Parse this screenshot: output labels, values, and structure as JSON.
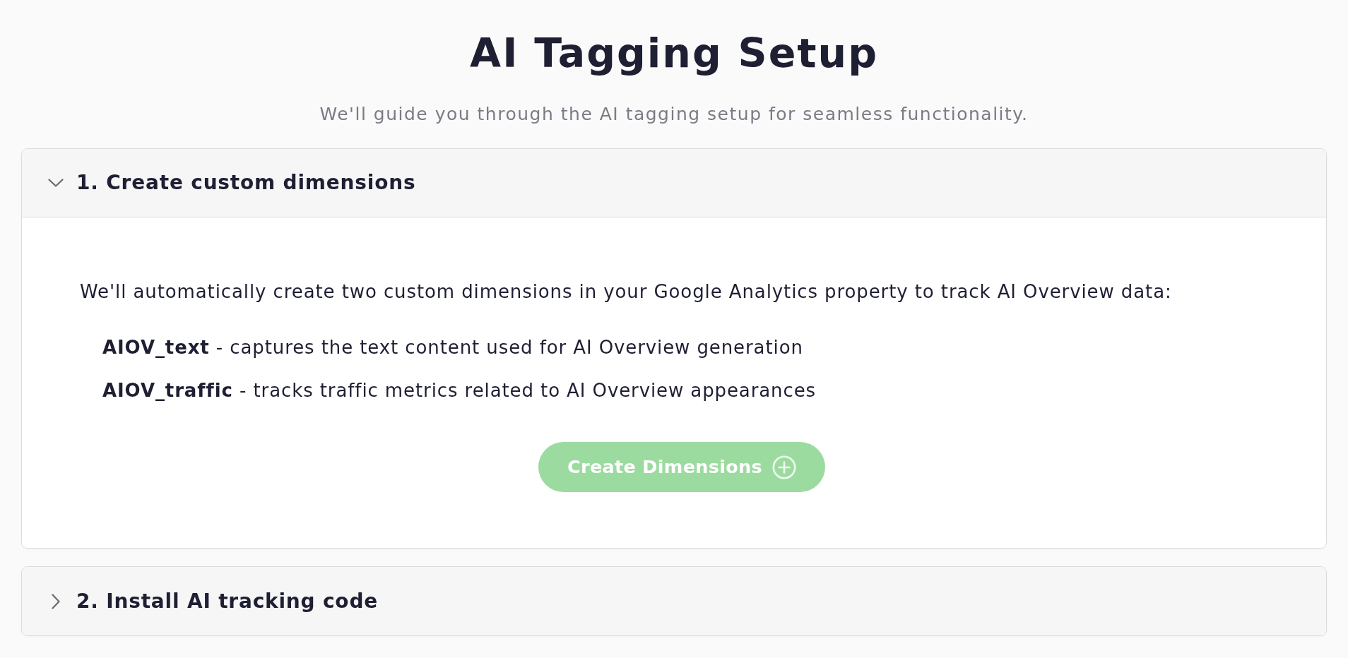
{
  "header": {
    "title": "AI Tagging Setup",
    "subtitle": "We'll guide you through the AI tagging setup for seamless functionality."
  },
  "steps": [
    {
      "title": "1. Create custom dimensions",
      "expanded": true,
      "intro": "We'll automatically create two custom dimensions in your Google Analytics property to track AI Overview data:",
      "items": [
        "**AIOV_text** - captures the text content used for AI Overview generation",
        "**AIOV_traffic** - tracks traffic metrics related to AI Overview appearances"
      ],
      "button": {
        "label": "Create Dimensions"
      }
    },
    {
      "title": "2. Install AI tracking code",
      "expanded": false
    }
  ]
}
